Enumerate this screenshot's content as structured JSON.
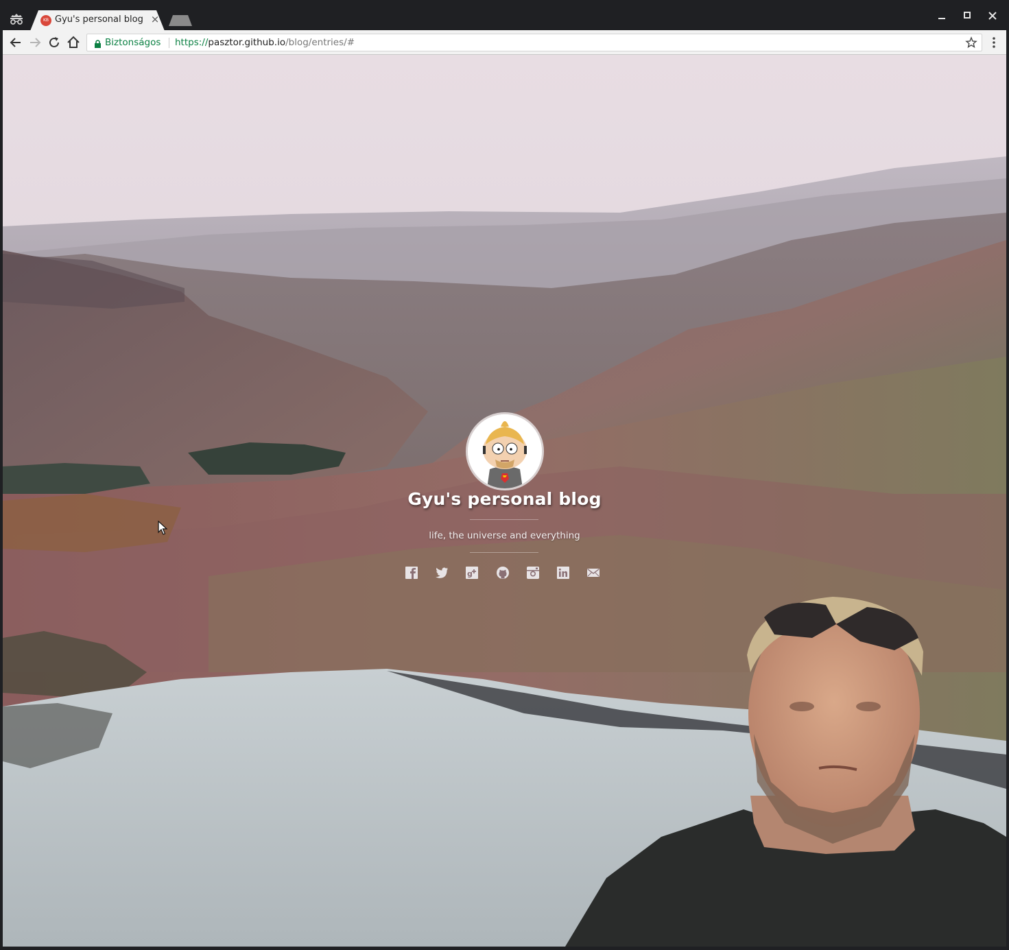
{
  "browser": {
    "tab_title": "Gyu's personal blog",
    "tab_favicon_text": "KB",
    "security_label": "Biztonságos",
    "url_scheme": "https://",
    "url_host": "pasztor.github.io",
    "url_path": "/blog/entries/#"
  },
  "hero": {
    "title": "Gyu's personal blog",
    "subtitle": "life, the universe and everything"
  },
  "social_icons": [
    "facebook-icon",
    "twitter-icon",
    "google-plus-icon",
    "github-icon",
    "instagram-icon",
    "linkedin-icon",
    "email-icon"
  ],
  "colors": {
    "secure_green": "#0b8043",
    "chrome_dark": "#1f2023",
    "favicon_red": "#d9473a"
  }
}
